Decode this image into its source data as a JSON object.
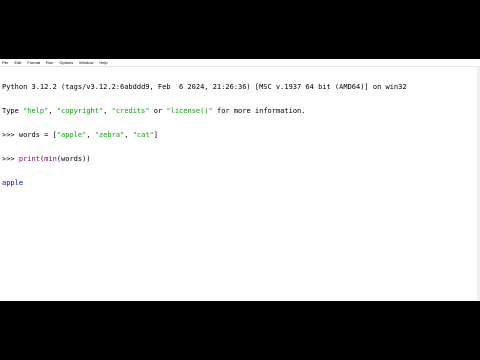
{
  "menu": {
    "items": [
      "File",
      "Edit",
      "Format",
      "Run",
      "Options",
      "Window",
      "Help"
    ]
  },
  "shell": {
    "banner_line1": "Python 3.12.2 (tags/v3.12.2:6abddd9, Feb  6 2024, 21:26:36) [MSC v.1937 64 bit (AMD64)] on win32",
    "banner_line2": {
      "t1": "Type ",
      "help": "\"help\"",
      "sep1": ", ",
      "copyright": "\"copyright\"",
      "sep2": ", ",
      "credits": "\"credits\"",
      "sep3": " or ",
      "license": "\"license()\"",
      "t2": " for more information."
    },
    "cmd1": {
      "prompt": ">>> ",
      "code_a": "words = [",
      "s1": "\"apple\"",
      "c1": ", ",
      "s2": "\"zebra\"",
      "c2": ", ",
      "s3": "\"cat\"",
      "code_b": "]"
    },
    "cmd2": {
      "prompt": ">>> ",
      "fn_print": "print",
      "p1": "(",
      "fn_min": "min",
      "p2": "(words))"
    },
    "output": "apple"
  },
  "colors": {
    "string": "#00aa00",
    "builtin": "#900090",
    "output": "#0000ff",
    "background": "#ffffff",
    "letterbox": "#000000"
  }
}
